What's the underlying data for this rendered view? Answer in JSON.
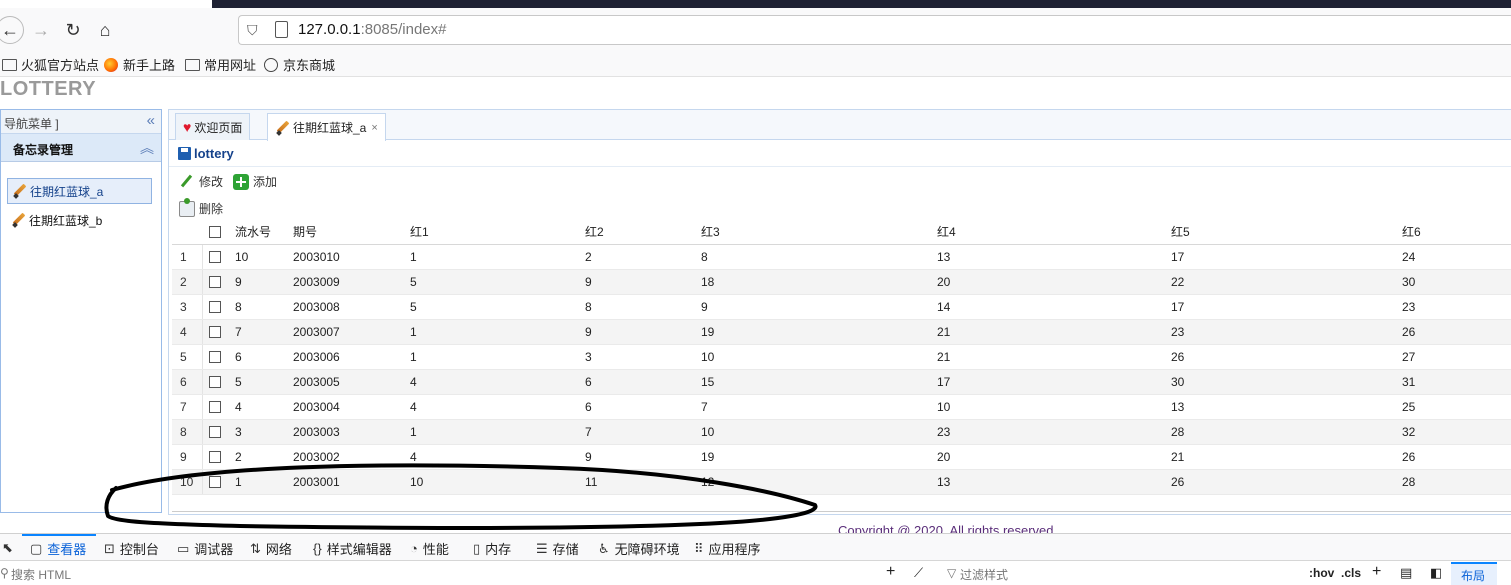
{
  "browser": {
    "url_host": "127.0.0.1",
    "url_rest": ":8085/index#",
    "back_icon": "←",
    "forward_icon": "→",
    "reload_icon": "↻",
    "home_icon": "⌂",
    "bookmarks": [
      "火狐官方站点",
      "新手上路",
      "常用网址",
      "京东商城"
    ]
  },
  "app": {
    "logo": "LOTTERY",
    "copyright": "Copyright @ 2020. All rights reserved"
  },
  "sidebar": {
    "title": "导航菜单 ]",
    "collapse_icon": "«",
    "group_title": "备忘录管理",
    "group_toggle_icon": "︽",
    "items": [
      {
        "label": "往期红蓝球_a",
        "selected": true
      },
      {
        "label": "往期红蓝球_b",
        "selected": false
      }
    ]
  },
  "tabs": [
    {
      "label": "欢迎页面",
      "icon": "♥"
    },
    {
      "label": "往期红蓝球_a",
      "close": "×"
    }
  ],
  "pane": {
    "title": "lottery",
    "toolbar": {
      "edit": "修改",
      "add": "添加",
      "delete": "删除"
    }
  },
  "grid": {
    "columns": [
      "流水号",
      "期号",
      "红1",
      "红2",
      "红3",
      "红4",
      "红5",
      "红6"
    ],
    "rows": [
      [
        "1",
        "10",
        "2003010",
        "1",
        "2",
        "8",
        "13",
        "17",
        "24"
      ],
      [
        "2",
        "9",
        "2003009",
        "5",
        "9",
        "18",
        "20",
        "22",
        "30"
      ],
      [
        "3",
        "8",
        "2003008",
        "5",
        "8",
        "9",
        "14",
        "17",
        "23"
      ],
      [
        "4",
        "7",
        "2003007",
        "1",
        "9",
        "19",
        "21",
        "23",
        "26"
      ],
      [
        "5",
        "6",
        "2003006",
        "1",
        "3",
        "10",
        "21",
        "26",
        "27"
      ],
      [
        "6",
        "5",
        "2003005",
        "4",
        "6",
        "15",
        "17",
        "30",
        "31"
      ],
      [
        "7",
        "4",
        "2003004",
        "4",
        "6",
        "7",
        "10",
        "13",
        "25"
      ],
      [
        "8",
        "3",
        "2003003",
        "1",
        "7",
        "10",
        "23",
        "28",
        "32"
      ],
      [
        "9",
        "2",
        "2003002",
        "4",
        "9",
        "19",
        "20",
        "21",
        "26"
      ],
      [
        "10",
        "1",
        "2003001",
        "10",
        "11",
        "12",
        "13",
        "26",
        "28"
      ]
    ]
  },
  "devtools": {
    "tabs": [
      "查看器",
      "控制台",
      "调试器",
      "网络",
      "样式编辑器",
      "性能",
      "内存",
      "存储",
      "无障碍环境",
      "应用程序"
    ],
    "search_placeholder": "搜索 HTML",
    "filter_placeholder": "过滤样式",
    "hov": ":hov",
    "cls": ".cls",
    "layout": "布局"
  }
}
